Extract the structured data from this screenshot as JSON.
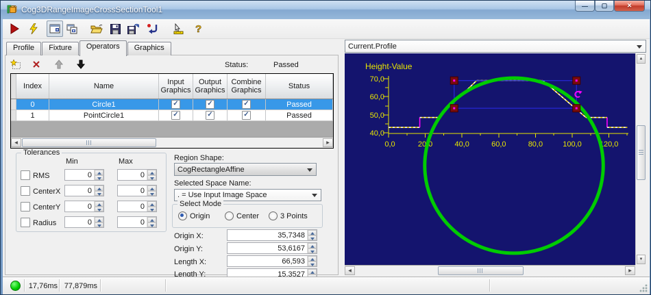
{
  "window": {
    "title": "Cog3DRangeImageCrossSectionTool1"
  },
  "toolbar": {
    "icons": [
      "run",
      "run-electric",
      "show-in-tool-window",
      "copy-to-tool-window",
      "open-file",
      "save-file",
      "save-file-as",
      "reset",
      "measure",
      "help"
    ]
  },
  "tabs": {
    "items": [
      {
        "label": "Profile",
        "active": false
      },
      {
        "label": "Fixture",
        "active": false
      },
      {
        "label": "Operators",
        "active": true
      },
      {
        "label": "Graphics",
        "active": false
      }
    ]
  },
  "operators": {
    "toolbar": {
      "status_label": "Status:",
      "status_value": "Passed",
      "icons": [
        "add-operator",
        "delete-operator",
        "move-up",
        "move-down"
      ]
    },
    "table": {
      "columns": [
        "Index",
        "Name",
        "Input Graphics",
        "Output Graphics",
        "Combine Graphics",
        "Status"
      ],
      "rows": [
        {
          "index": "0",
          "name": "Circle1",
          "input_graphics": true,
          "output_graphics": true,
          "combine_graphics": true,
          "status": "Passed",
          "selected": true
        },
        {
          "index": "1",
          "name": "PointCircle1",
          "input_graphics": true,
          "output_graphics": true,
          "combine_graphics": true,
          "status": "Passed",
          "selected": false
        }
      ]
    }
  },
  "tolerances": {
    "title": "Tolerances",
    "min_header": "Min",
    "max_header": "Max",
    "rows": [
      {
        "label": "RMS",
        "checked": false,
        "min": "0",
        "max": "0"
      },
      {
        "label": "CenterX",
        "checked": false,
        "min": "0",
        "max": "0"
      },
      {
        "label": "CenterY",
        "checked": false,
        "min": "0",
        "max": "0"
      },
      {
        "label": "Radius",
        "checked": false,
        "min": "0",
        "max": "0"
      }
    ]
  },
  "region": {
    "shape_label": "Region Shape:",
    "shape_value": "CogRectangleAffine",
    "space_label": "Selected Space Name:",
    "space_value": ". = Use Input Image Space",
    "select_mode_title": "Select Mode",
    "modes": [
      {
        "label": "Origin",
        "selected": true
      },
      {
        "label": "Center",
        "selected": false
      },
      {
        "label": "3 Points",
        "selected": false
      }
    ],
    "fields": [
      {
        "label": "Origin X:",
        "value": "35,7348"
      },
      {
        "label": "Origin Y:",
        "value": "53,6167"
      },
      {
        "label": "Length X:",
        "value": "66,593"
      },
      {
        "label": "Length Y:",
        "value": "15,3527"
      }
    ]
  },
  "profile_panel": {
    "selector_value": "Current.Profile",
    "chart_data": {
      "type": "line",
      "title": "Height-Value",
      "x_ticks": [
        "0,0",
        "20,0",
        "40,0",
        "60,0",
        "80,0",
        "100,0",
        "120,0"
      ],
      "y_ticks": [
        "70,0",
        "60,0",
        "50,0",
        "40,0"
      ],
      "x_range": [
        0,
        130
      ],
      "y_range": [
        40,
        72
      ],
      "bg_color": "#14146E",
      "axis_color": "#E8E600",
      "profile_color": "#FFE200",
      "profile_dash_color": "#FFFFFF",
      "step_color": "#FF00FF",
      "profile_points": [
        [
          0,
          43
        ],
        [
          17,
          43
        ],
        [
          17,
          48.5
        ],
        [
          27,
          48.5
        ],
        [
          48,
          69
        ],
        [
          84,
          69
        ],
        [
          107.5,
          48.5
        ],
        [
          119,
          48.5
        ],
        [
          119,
          43
        ],
        [
          130,
          43
        ]
      ],
      "region_rect": {
        "x": 35.7348,
        "y": 53.6167,
        "w": 66.593,
        "h": 15.3527,
        "color": "#2828D8",
        "handle_color": "#7A0C0C",
        "handle_dot_color": "#FF00FF"
      },
      "fit_circle": {
        "cx": 68.3,
        "cy": 21.8,
        "r": 48.6,
        "color": "#00CC00"
      }
    }
  },
  "statusbar": {
    "indicator_color": "#00CC00",
    "time1": "17,76ms",
    "time2": "77,879ms"
  }
}
